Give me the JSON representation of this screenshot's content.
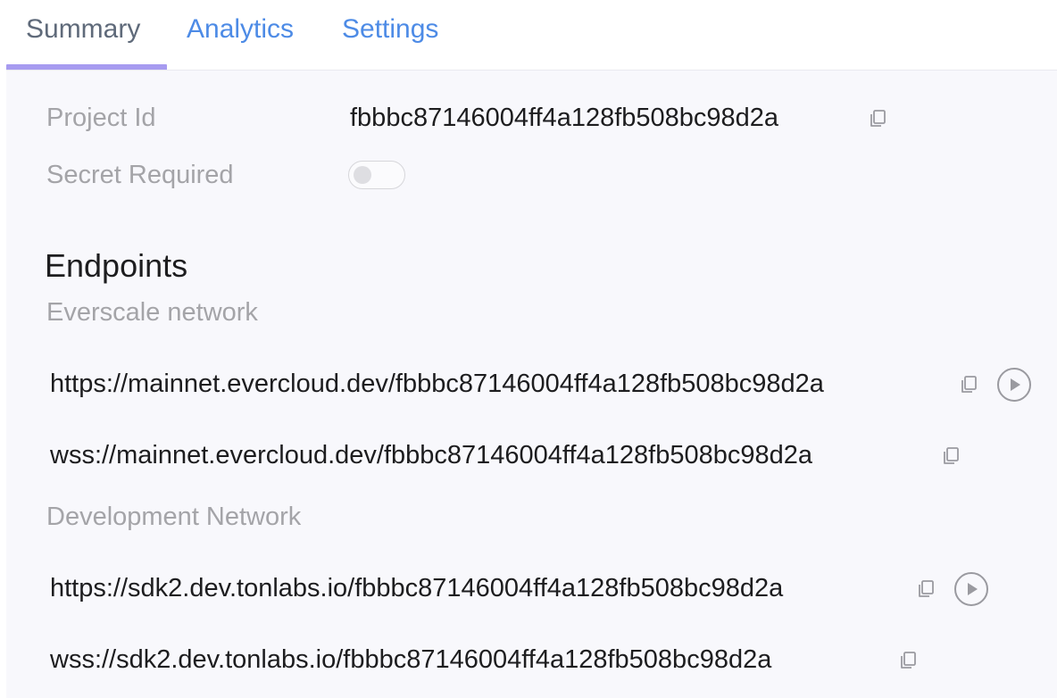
{
  "tabs": [
    {
      "label": "Summary"
    },
    {
      "label": "Analytics"
    },
    {
      "label": "Settings"
    }
  ],
  "project": {
    "id_label": "Project Id",
    "id_value": "fbbbc87146004ff4a128fb508bc98d2a",
    "secret_label": "Secret Required",
    "secret_enabled": false
  },
  "endpoints": {
    "heading": "Endpoints",
    "everscale": {
      "label": "Everscale network",
      "https": "https://mainnet.evercloud.dev/fbbbc87146004ff4a128fb508bc98d2a",
      "wss": "wss://mainnet.evercloud.dev/fbbbc87146004ff4a128fb508bc98d2a"
    },
    "development": {
      "label": "Development Network",
      "https": "https://sdk2.dev.tonlabs.io/fbbbc87146004ff4a128fb508bc98d2a",
      "wss": "wss://sdk2.dev.tonlabs.io/fbbbc87146004ff4a128fb508bc98d2a"
    }
  },
  "colors": {
    "accent_underline": "#a79bf0",
    "link": "#4d8be6",
    "panel_bg": "#f8f8fc",
    "muted_text": "#a4a4a8"
  },
  "icons": [
    "copy-icon",
    "play-icon"
  ]
}
